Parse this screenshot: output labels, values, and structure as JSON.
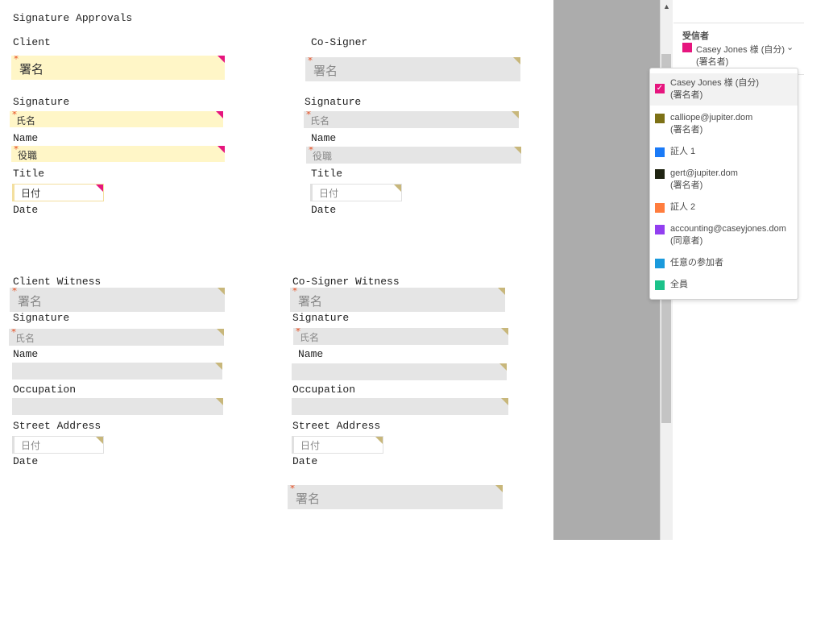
{
  "document": {
    "title": "Signature Approvals",
    "client_heading": "Client",
    "cosigner_heading": "Co-Signer",
    "client_witness_heading": "Client Witness",
    "cosigner_witness_heading": "Co-Signer Witness",
    "labels": {
      "signature": "Signature",
      "name": "Name",
      "title": "Title",
      "date": "Date",
      "occupation": "Occupation",
      "street_address": "Street Address"
    },
    "fields": {
      "signature": "署名",
      "name": "氏名",
      "title": "役職",
      "date": "日付",
      "required_mark": "*"
    }
  },
  "scrollbar": {
    "up_icon": "▲"
  },
  "recipients_panel": {
    "heading": "受信者",
    "selected_name": "Casey Jones 様 (自分)",
    "selected_role": "(署名者)",
    "selected_color": "#e6157e",
    "chevron": "⌄"
  },
  "dropdown": {
    "check_glyph": "✓",
    "items": [
      {
        "name": "Casey Jones 様 (自分)",
        "role": "(署名者)",
        "color": "#e6157e"
      },
      {
        "name": "calliope@jupiter.dom",
        "role": "(署名者)",
        "color": "#7d7116"
      },
      {
        "name": "証人 1",
        "role": "",
        "color": "#1a7af7"
      },
      {
        "name": "gert@jupiter.dom",
        "role": "(署名者)",
        "color": "#1f2412"
      },
      {
        "name": "証人 2",
        "role": "",
        "color": "#ff7d3e"
      },
      {
        "name": "accounting@caseyjones.dom",
        "role": "(同意者)",
        "color": "#923ff0"
      },
      {
        "name": "任意の参加者",
        "role": "",
        "color": "#1a9adc"
      },
      {
        "name": "全員",
        "role": "",
        "color": "#1cc28a"
      }
    ]
  }
}
